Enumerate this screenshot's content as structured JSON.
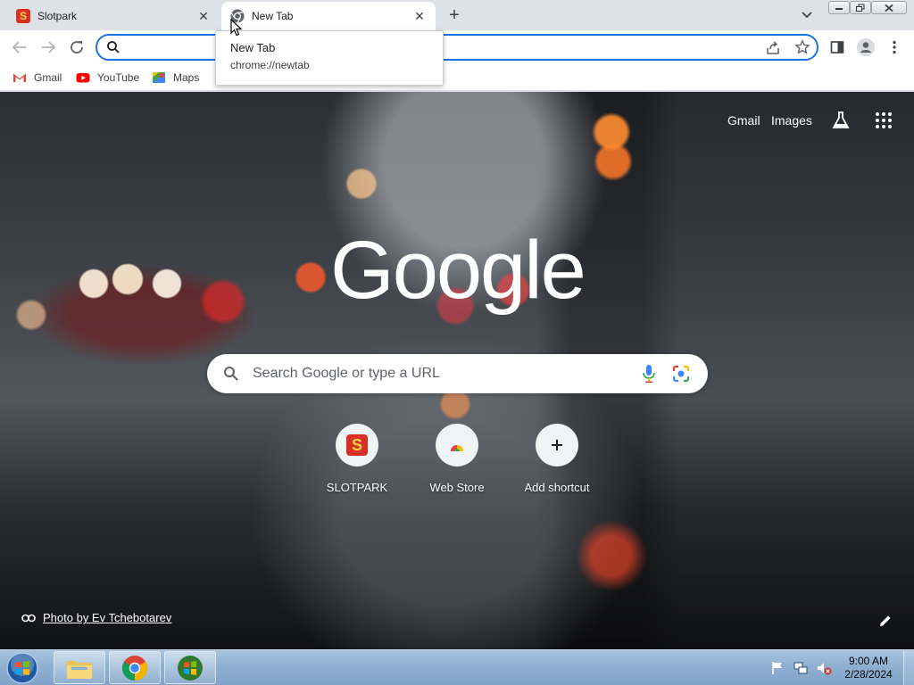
{
  "tabs": [
    {
      "title": "Slotpark",
      "favicon": "slotpark-s-icon",
      "active": false
    },
    {
      "title": "New Tab",
      "favicon": "chrome-icon",
      "active": true
    }
  ],
  "tab_tooltip": {
    "title": "New Tab",
    "url": "chrome://newtab"
  },
  "omnibox": {
    "value": "",
    "placeholder": ""
  },
  "bookmarks": [
    {
      "label": "Gmail",
      "icon": "gmail-icon"
    },
    {
      "label": "YouTube",
      "icon": "youtube-icon"
    },
    {
      "label": "Maps",
      "icon": "maps-icon"
    }
  ],
  "ntp": {
    "header_links": [
      "Gmail",
      "Images"
    ],
    "logo_text": "Google",
    "search_placeholder": "Search Google or type a URL",
    "shortcuts": [
      {
        "label": "SLOTPARK",
        "icon": "slotpark-s-icon"
      },
      {
        "label": "Web Store",
        "icon": "web-store-icon"
      },
      {
        "label": "Add shortcut",
        "icon": "plus-icon"
      }
    ],
    "photo_credit": "Photo by Ev Tchebotarev"
  },
  "taskbar": {
    "clock_time": "9:00 AM",
    "clock_date": "2/28/2024"
  },
  "colors": {
    "accent_blue": "#1a73e8",
    "tab_strip": "#dee1e6",
    "slotpark_red": "#d93025",
    "slotpark_yellow": "#ffd54a"
  }
}
